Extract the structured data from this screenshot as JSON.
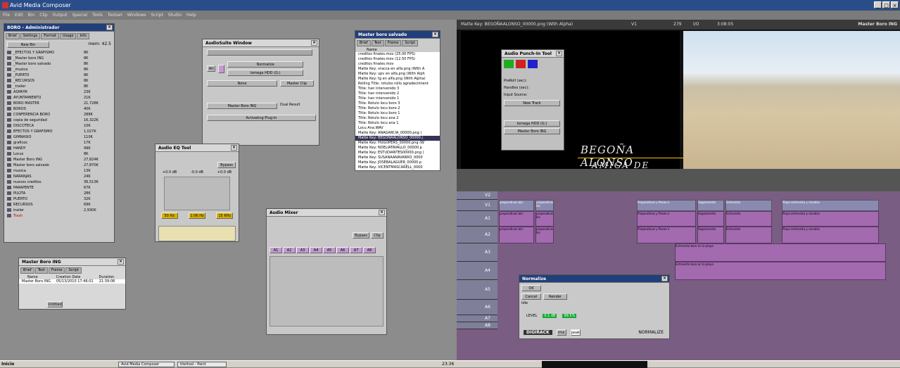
{
  "app": {
    "title": "Avid Media Composer"
  },
  "menu": [
    "File",
    "Edit",
    "Bin",
    "Clip",
    "Output",
    "Special",
    "Tools",
    "Toolset",
    "Windows",
    "Script",
    "Studio",
    "Help"
  ],
  "bin_window": {
    "title": "BORO - Administrador",
    "tabs": [
      "Brief",
      "Settings",
      "Format",
      "Usage",
      "Info"
    ],
    "new_bin": "New Bin",
    "mem": "mem: 42.5",
    "items": [
      [
        "_EFECTOS Y GRAFISMO",
        "8K"
      ],
      [
        "_Master boro ING",
        "8K"
      ],
      [
        "_Master boro salvado",
        "8K"
      ],
      [
        "_musica",
        "8K"
      ],
      [
        "_PUERTO",
        "8K"
      ],
      [
        "_RECURSOS",
        "8K"
      ],
      [
        "_trailer",
        "8K"
      ],
      [
        "ASPAYM",
        "23K"
      ],
      [
        "AYUNTAMIENTO",
        "21K"
      ],
      [
        "BORO MASTER",
        "21,728K"
      ],
      [
        "BOROS",
        "40K"
      ],
      [
        "CONFERENCIA BORO",
        "288K"
      ],
      [
        "copia de seguridad",
        "16,322K"
      ],
      [
        "DISCOTECA",
        "10K"
      ],
      [
        "EFECTOS Y GRAFISMO",
        "1,027K"
      ],
      [
        "GIMNASIO",
        "110K"
      ],
      [
        "graficos",
        "17K"
      ],
      [
        "HANDY",
        "49K"
      ],
      [
        "Locus",
        "8K"
      ],
      [
        "Master Boro ING",
        "27,824K"
      ],
      [
        "Master boro salvado",
        "27,870K"
      ],
      [
        "musica",
        "13K"
      ],
      [
        "NARANJAS",
        "24K"
      ],
      [
        "nuevos creditos",
        "36,513K"
      ],
      [
        "PARAPENTE",
        "67K"
      ],
      [
        "PILOTA",
        "28K"
      ],
      [
        "PUERTO",
        "32K"
      ],
      [
        "RECURSOS",
        "69K"
      ],
      [
        "trailer",
        "2,930K"
      ],
      [
        "Trash",
        ""
      ]
    ]
  },
  "audiosuite": {
    "title": "AudioSuite Window",
    "plugin": "Normalize",
    "drive": "Iomega HDD (G:)",
    "none": "None",
    "master_clip": "Master Clip",
    "seq": "Master Boro ING",
    "dual": "Dual Result",
    "activate": "Activating Plug-In"
  },
  "eq_tool": {
    "title": "Audio EQ Tool",
    "bypass": "Bypass",
    "freqs": [
      "50 Hz",
      "1.0K Hz",
      "15 KHz"
    ],
    "db": [
      "+0.0 dB",
      "-0.0 dB",
      "+0.0 dB"
    ]
  },
  "mixer": {
    "title": "Audio Mixer",
    "tracks": [
      "A1",
      "A2",
      "A3",
      "A4",
      "A5",
      "A6",
      "A7",
      "A8"
    ],
    "bypass": "Bypass",
    "clip": "Clip"
  },
  "small_bin": {
    "title": "Master Boro ING",
    "tabs": [
      "Brief",
      "Text",
      "Frame",
      "Script"
    ],
    "cols": [
      "Name",
      "Creation Date",
      "Duration"
    ],
    "row": [
      "Master Boro ING",
      "05/13/2010 17:46:01",
      "21:39:08"
    ],
    "untitled": "Untitled"
  },
  "salvado_bin": {
    "title": "Master boro salvado",
    "tabs": [
      "Brief",
      "Text",
      "Frame",
      "Script"
    ],
    "col": "Name",
    "items": [
      "creditos finales.mov (25.00 FPS)",
      "creditos finales.mov (12.50 FPS)",
      "creditos finales.mov",
      "Matte Key: vracca en alfa.png (With A",
      "Matte Key: upv en alfa.png (With Alph",
      "Matte Key: tg en alfa.png (With Alpha)",
      "Rolling Title: rotulos rollo agradecimient",
      "Title: han intervenido 3",
      "Title: han intervenido 2",
      "Title: han intervenido 1",
      "Title: Rotulo locu boro 3",
      "Title: Rotulo locu boro 2",
      "Title: Rotulo locu boro 1",
      "Title: Rotulo locu ana 2",
      "Title: Rotulo locu ana 1",
      "Locu Ana.WAV",
      "Matte Key: ANAGARCIA_00000.png (",
      "Matte Key: BEGOÑAALONSO_00000.j",
      "Matte Key: HUGOPERS_00000.png (W",
      "Matte Key: NOELIATAVALLO_00000.p",
      "Matte Key: ESTUDIANTES00000.png (",
      "Matte Key: SUSANAANAVARRO_0000",
      "Matte Key: JOSEBALAGUER_00000.p",
      "Matte Key: VICENTMASCARELL_0000"
    ]
  },
  "monitor": {
    "header": "Matte Key: BEGOÑAALONSO_00000.png (With Alpha)",
    "v1": "V1",
    "num": "279",
    "io": "I/O",
    "tc": "3:08:05",
    "right": "Master Boro ING",
    "name": "BEGOÑA ALONSO",
    "sub": "AMIGA DE BORO"
  },
  "punchin": {
    "title": "Audio Punch-In Tool",
    "preroll": "PreRoll (sec):",
    "handles": "Handles (sec):",
    "input": "Input Source:",
    "new_track": "New Track",
    "drive": "Iomega HDD (G:)",
    "seq": "Master Boro ING"
  },
  "normalize": {
    "title": "Normalize",
    "ok": "OK",
    "cancel": "Cancel",
    "render": "Render",
    "idle": "Idle",
    "level": "LEVEL",
    "l1": "0.1 dB",
    "l2": "99.5%",
    "brand": "DIGIRACK",
    "rms": "rms",
    "peak": "peak",
    "label": "NORMALIZE"
  },
  "timeline": {
    "tracks": [
      "V2",
      "V1",
      "A1",
      "A2",
      "A3",
      "A4",
      "A5",
      "A6",
      "A7",
      "A8"
    ],
    "clips": [
      "preparativos bici",
      "preparativos bic",
      "Preparativos y Paseo e",
      "Seguimiento",
      "Entrevista",
      "Playa entrevista y rocodos",
      "Entrevista boro en la playa"
    ]
  },
  "taskbar": {
    "start": "Inicio",
    "app": "Avid Media Composer",
    "paint": "titeltool - Paint",
    "clock": "23:36"
  }
}
